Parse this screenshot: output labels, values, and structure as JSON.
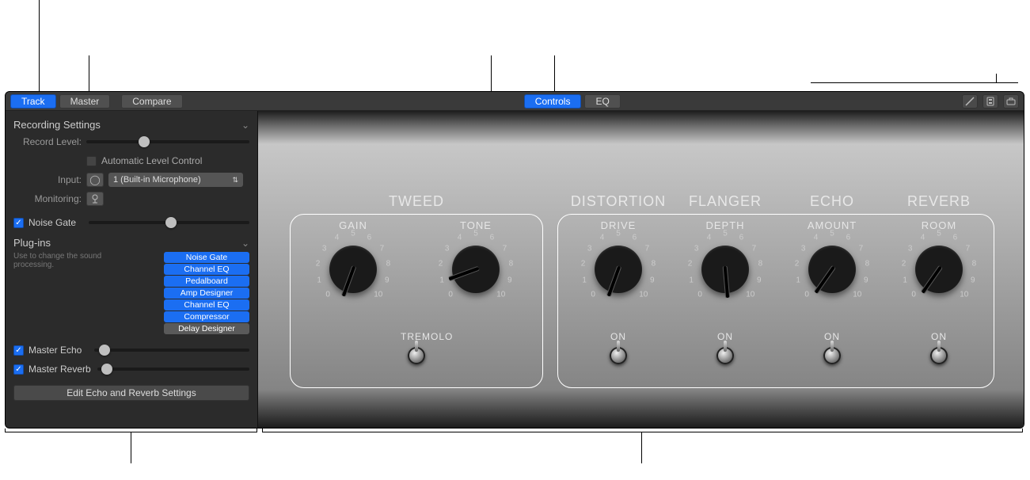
{
  "topbar": {
    "left": {
      "track": "Track",
      "master": "Master",
      "compare": "Compare"
    },
    "center": {
      "controls": "Controls",
      "eq": "EQ"
    }
  },
  "sidebar": {
    "recording": {
      "title": "Recording Settings",
      "record_level_label": "Record Level:",
      "auto_level_label": "Automatic Level Control",
      "input_label": "Input:",
      "input_value": "1  (Built-in Microphone)",
      "monitoring_label": "Monitoring:"
    },
    "noise_gate_label": "Noise Gate",
    "plugins": {
      "title": "Plug-ins",
      "help": "Use to change the sound processing.",
      "items": [
        {
          "label": "Noise Gate",
          "on": true
        },
        {
          "label": "Channel EQ",
          "on": true
        },
        {
          "label": "Pedalboard",
          "on": true
        },
        {
          "label": "Amp Designer",
          "on": true
        },
        {
          "label": "Channel EQ",
          "on": true
        },
        {
          "label": "Compressor",
          "on": true
        },
        {
          "label": "Delay Designer",
          "on": false
        }
      ]
    },
    "master_echo_label": "Master Echo",
    "master_reverb_label": "Master Reverb",
    "edit_button": "Edit Echo and Reverb Settings"
  },
  "stage": {
    "tweed": {
      "title": "TWEED",
      "knobs": [
        {
          "label": "GAIN",
          "angle": 20
        },
        {
          "label": "TONE",
          "angle": 70
        }
      ],
      "toggle_label": "TREMOLO"
    },
    "fx": [
      {
        "title": "DISTORTION",
        "knob": "DRIVE",
        "angle": 20,
        "toggle": "ON"
      },
      {
        "title": "FLANGER",
        "knob": "DEPTH",
        "angle": -5,
        "toggle": "ON"
      },
      {
        "title": "ECHO",
        "knob": "AMOUNT",
        "angle": 35,
        "toggle": "ON"
      },
      {
        "title": "REVERB",
        "knob": "ROOM",
        "angle": 35,
        "toggle": "ON"
      }
    ],
    "scale": [
      "0",
      "1",
      "2",
      "3",
      "4",
      "5",
      "6",
      "7",
      "8",
      "9",
      "10"
    ]
  }
}
